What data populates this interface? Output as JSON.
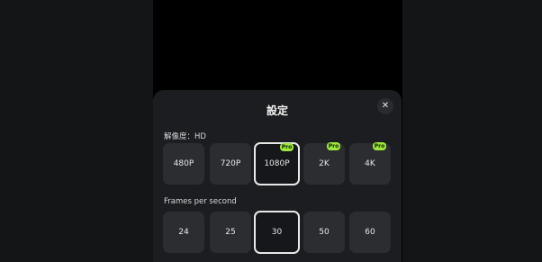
{
  "settings_sheet": {
    "title": "設定",
    "close_icon": "close-icon",
    "resolution": {
      "label": "解像度：HD",
      "selected": "1080P",
      "options": [
        {
          "label": "480P",
          "pro_badge": ""
        },
        {
          "label": "720P",
          "pro_badge": ""
        },
        {
          "label": "1080P",
          "pro_badge": "Pro"
        },
        {
          "label": "2K",
          "pro_badge": "Pro"
        },
        {
          "label": "4K",
          "pro_badge": "Pro"
        }
      ]
    },
    "frame_rate": {
      "label": "Frames per second",
      "selected": "30",
      "options": [
        {
          "label": "24"
        },
        {
          "label": "25"
        },
        {
          "label": "30"
        },
        {
          "label": "50"
        },
        {
          "label": "60"
        }
      ]
    }
  },
  "colors": {
    "sheet_background": "#1c1d20",
    "option_background": "#2c2d31",
    "selected_border": "#e8e8e8",
    "pro_badge": "#9de83d"
  }
}
